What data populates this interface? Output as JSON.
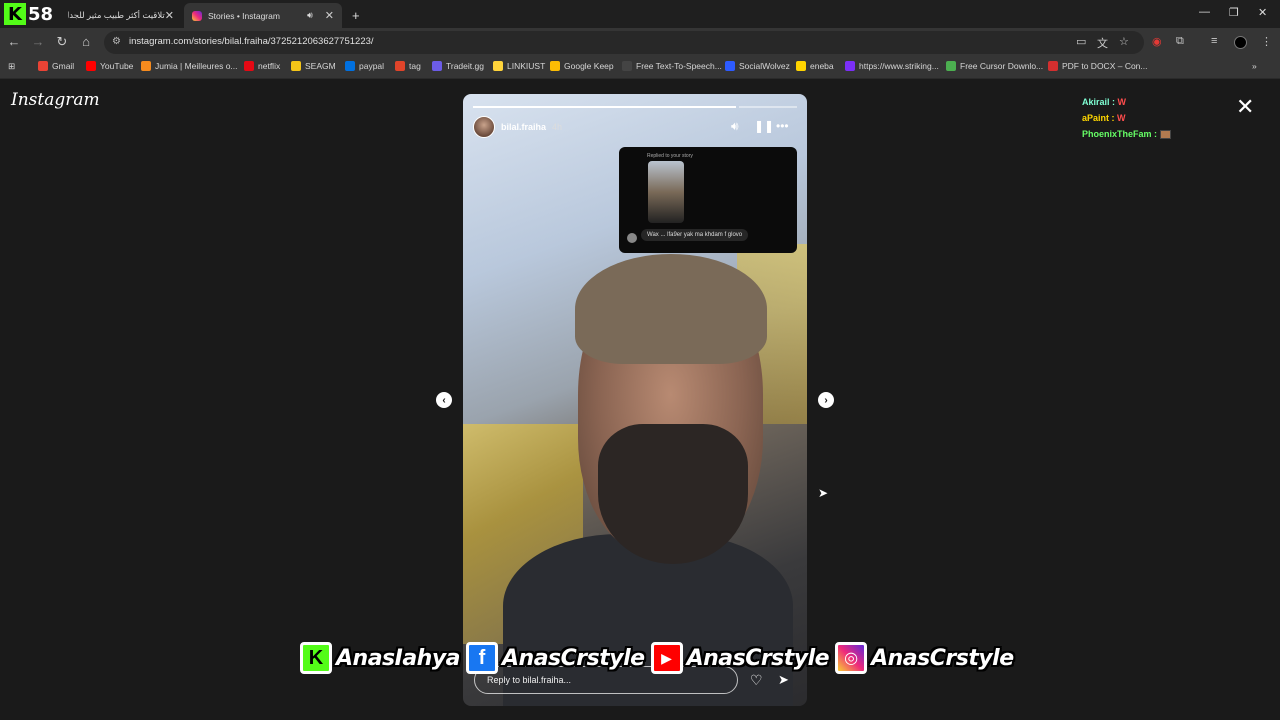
{
  "browser": {
    "overlay_badge": {
      "k": "K",
      "num": "58"
    },
    "tabs": [
      {
        "title": "تلاقيت أكثر طبيب مثير للجدل فا",
        "active": false
      },
      {
        "title": "Stories • Instagram",
        "active": true
      }
    ],
    "new_tab_label": "+",
    "url": "instagram.com/stories/bilal.fraiha/3725212063627751223/",
    "bookmarks": [
      {
        "label": "Gmail",
        "color": "#ea4335"
      },
      {
        "label": "YouTube",
        "color": "#ff0000"
      },
      {
        "label": "Jumia | Meilleures o...",
        "color": "#f68b1e"
      },
      {
        "label": "netflix",
        "color": "#e50914"
      },
      {
        "label": "SEAGM",
        "color": "#f5c518"
      },
      {
        "label": "paypal",
        "color": "#0070e0"
      },
      {
        "label": "tag",
        "color": "#e0442a"
      },
      {
        "label": "Tradeit.gg",
        "color": "#6c5ce7"
      },
      {
        "label": "LINKIUST",
        "color": "#ffd43b"
      },
      {
        "label": "Google Keep",
        "color": "#fbbc04"
      },
      {
        "label": "Free Text-To-Speech...",
        "color": "#444444"
      },
      {
        "label": "SocialWolvez",
        "color": "#2d5bff"
      },
      {
        "label": "eneba",
        "color": "#ffd400"
      },
      {
        "label": "https://www.striking...",
        "color": "#7b2ff7"
      },
      {
        "label": "Free Cursor Downlo...",
        "color": "#4caf50"
      },
      {
        "label": "PDF to DOCX – Con...",
        "color": "#d32f2f"
      }
    ]
  },
  "instagram": {
    "logo": "Instagram",
    "chat": [
      {
        "user": "Akirail :",
        "msg": "W",
        "color": "#7fffd4"
      },
      {
        "user": "aPaint :",
        "msg": "W",
        "color": "#ffd700"
      },
      {
        "user": "PhoenixTheFam :",
        "msg": "",
        "color": "#66ff66"
      }
    ],
    "story": {
      "username": "bilal.fraiha",
      "time": "4h",
      "reply_card": {
        "caption": "Replied to your story",
        "message": "Wax ... lfa9er yak ma khdam f glovo"
      },
      "reply_placeholder": "Reply to bilal.fraiha..."
    }
  },
  "overlay": {
    "handles": [
      {
        "icon": "K",
        "text": "AnasIahya",
        "bg": "#53fc18",
        "fg": "#000000"
      },
      {
        "icon": "f",
        "text": "AnasCrstyle",
        "bg": "#1877f2",
        "fg": "#ffffff"
      },
      {
        "icon": "▶",
        "text": "AnasCrstyle",
        "bg": "#ff0000",
        "fg": "#ffffff"
      },
      {
        "icon": "◎",
        "text": "AnasCrstyle",
        "bg": "#d62976",
        "fg": "#ffffff"
      }
    ]
  }
}
